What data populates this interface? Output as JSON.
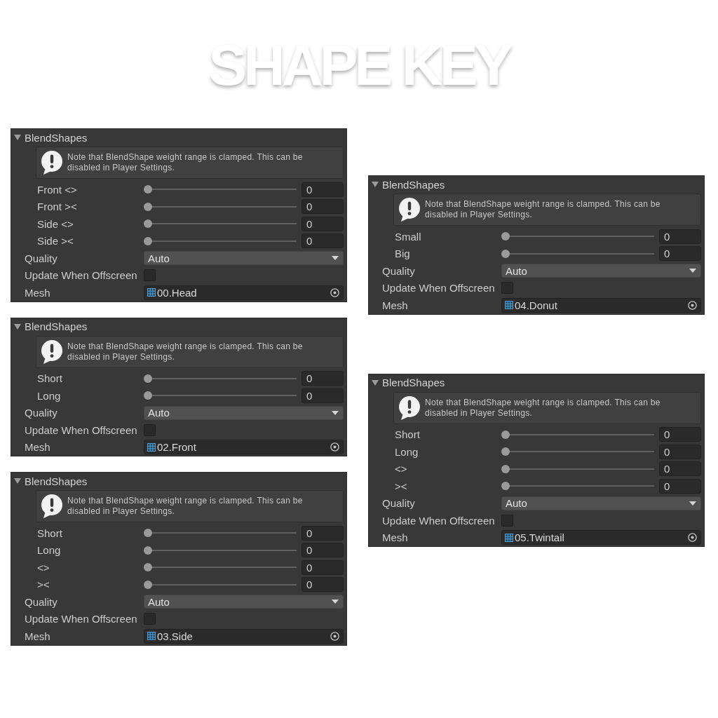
{
  "title": "SHAPE KEY",
  "columns": [
    {
      "panels": [
        {
          "header": "BlendShapes",
          "expanded": true,
          "help": "Note that BlendShape weight range is clamped. This can be disabled in Player Settings.",
          "shapes": [
            {
              "name": "Front <>",
              "level": 0,
              "value": "0"
            },
            {
              "name": "Front ><",
              "level": 0,
              "value": "0"
            },
            {
              "name": "Side <>",
              "level": 0,
              "value": "0"
            },
            {
              "name": "Side ><",
              "level": 0,
              "value": "0"
            }
          ],
          "quality": {
            "label": "Quality",
            "value": "Auto"
          },
          "update_offscreen": {
            "label": "Update When Offscreen",
            "checked": false
          },
          "mesh": {
            "label": "Mesh",
            "value": "00.Head"
          }
        },
        {
          "header": "BlendShapes",
          "expanded": true,
          "help": "Note that BlendShape weight range is clamped. This can be disabled in Player Settings.",
          "shapes": [
            {
              "name": "Short",
              "level": 0,
              "value": "0"
            },
            {
              "name": "Long",
              "level": 0,
              "value": "0"
            }
          ],
          "quality": {
            "label": "Quality",
            "value": "Auto"
          },
          "update_offscreen": {
            "label": "Update When Offscreen",
            "checked": false
          },
          "mesh": {
            "label": "Mesh",
            "value": "02.Front"
          }
        },
        {
          "header": "BlendShapes",
          "expanded": true,
          "help": "Note that BlendShape weight range is clamped. This can be disabled in Player Settings.",
          "shapes": [
            {
              "name": "Short",
              "level": 0,
              "value": "0"
            },
            {
              "name": "Long",
              "level": 0,
              "value": "0"
            },
            {
              "name": "<>",
              "level": 0,
              "value": "0"
            },
            {
              "name": "><",
              "level": 0,
              "value": "0"
            }
          ],
          "quality": {
            "label": "Quality",
            "value": "Auto"
          },
          "update_offscreen": {
            "label": "Update When Offscreen",
            "checked": false
          },
          "mesh": {
            "label": "Mesh",
            "value": "03.Side"
          }
        }
      ]
    },
    {
      "panels": [
        {
          "header": "BlendShapes",
          "expanded": true,
          "help": "Note that BlendShape weight range is clamped. This can be disabled in Player Settings.",
          "shapes": [
            {
              "name": "Small",
              "level": 0,
              "value": "0"
            },
            {
              "name": "Big",
              "level": 0,
              "value": "0"
            }
          ],
          "quality": {
            "label": "Quality",
            "value": "Auto"
          },
          "update_offscreen": {
            "label": "Update When Offscreen",
            "checked": false
          },
          "mesh": {
            "label": "Mesh",
            "value": "04.Donut"
          }
        },
        {
          "header": "BlendShapes",
          "expanded": true,
          "help": "Note that BlendShape weight range is clamped. This can be disabled in Player Settings.",
          "shapes": [
            {
              "name": "Short",
              "level": 0,
              "value": "0"
            },
            {
              "name": "Long",
              "level": 0,
              "value": "0"
            },
            {
              "name": "<>",
              "level": 0,
              "value": "0"
            },
            {
              "name": "><",
              "level": 0,
              "value": "0"
            }
          ],
          "quality": {
            "label": "Quality",
            "value": "Auto"
          },
          "update_offscreen": {
            "label": "Update When Offscreen",
            "checked": false
          },
          "mesh": {
            "label": "Mesh",
            "value": "05.Twintail"
          }
        }
      ]
    }
  ]
}
